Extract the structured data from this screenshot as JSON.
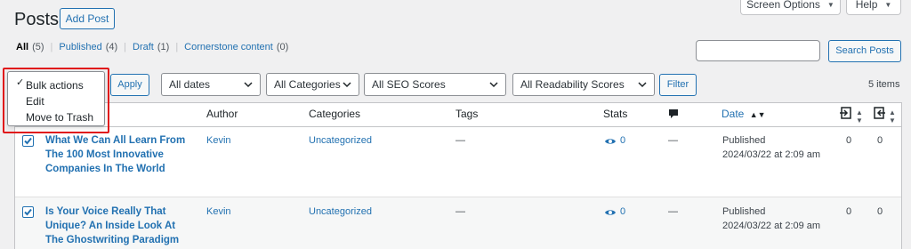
{
  "header": {
    "title": "Posts",
    "add_new": "Add Post",
    "screen_options": "Screen Options",
    "help": "Help"
  },
  "views": [
    {
      "label": "All",
      "count": "(5)",
      "current": true
    },
    {
      "label": "Published",
      "count": "(4)"
    },
    {
      "label": "Draft",
      "count": "(1)"
    },
    {
      "label": "Cornerstone content",
      "count": "(0)"
    }
  ],
  "search": {
    "button": "Search Posts",
    "value": ""
  },
  "bulk_actions": {
    "options": [
      "Bulk actions",
      "Edit",
      "Move to Trash"
    ],
    "selected": "Bulk actions",
    "apply": "Apply"
  },
  "filters": {
    "dates": "All dates",
    "categories": "All Categories",
    "seo_scores": "All SEO Scores",
    "readability": "All Readability Scores",
    "filter_button": "Filter"
  },
  "items_count": "5 items",
  "columns": {
    "author": "Author",
    "categories": "Categories",
    "tags": "Tags",
    "stats": "Stats",
    "date": "Date"
  },
  "rows": [
    {
      "checked": true,
      "title": "What We Can All Learn From The 100 Most Innovative Companies In The World",
      "author": "Kevin",
      "category": "Uncategorized",
      "tags": "—",
      "stats": "0",
      "comments": "—",
      "status": "Published",
      "date": "2024/03/22 at 2:09 am",
      "links_out": "0",
      "links_in": "0"
    },
    {
      "checked": true,
      "title": "Is Your Voice Really That Unique? An Inside Look At The Ghostwriting Paradigm",
      "author": "Kevin",
      "category": "Uncategorized",
      "tags": "—",
      "stats": "0",
      "comments": "—",
      "status": "Published",
      "date": "2024/03/22 at 2:09 am",
      "links_out": "0",
      "links_in": "0"
    }
  ],
  "colors": {
    "link": "#2271b1",
    "highlight_box": "#e0161a",
    "background": "#f0f0f1"
  }
}
